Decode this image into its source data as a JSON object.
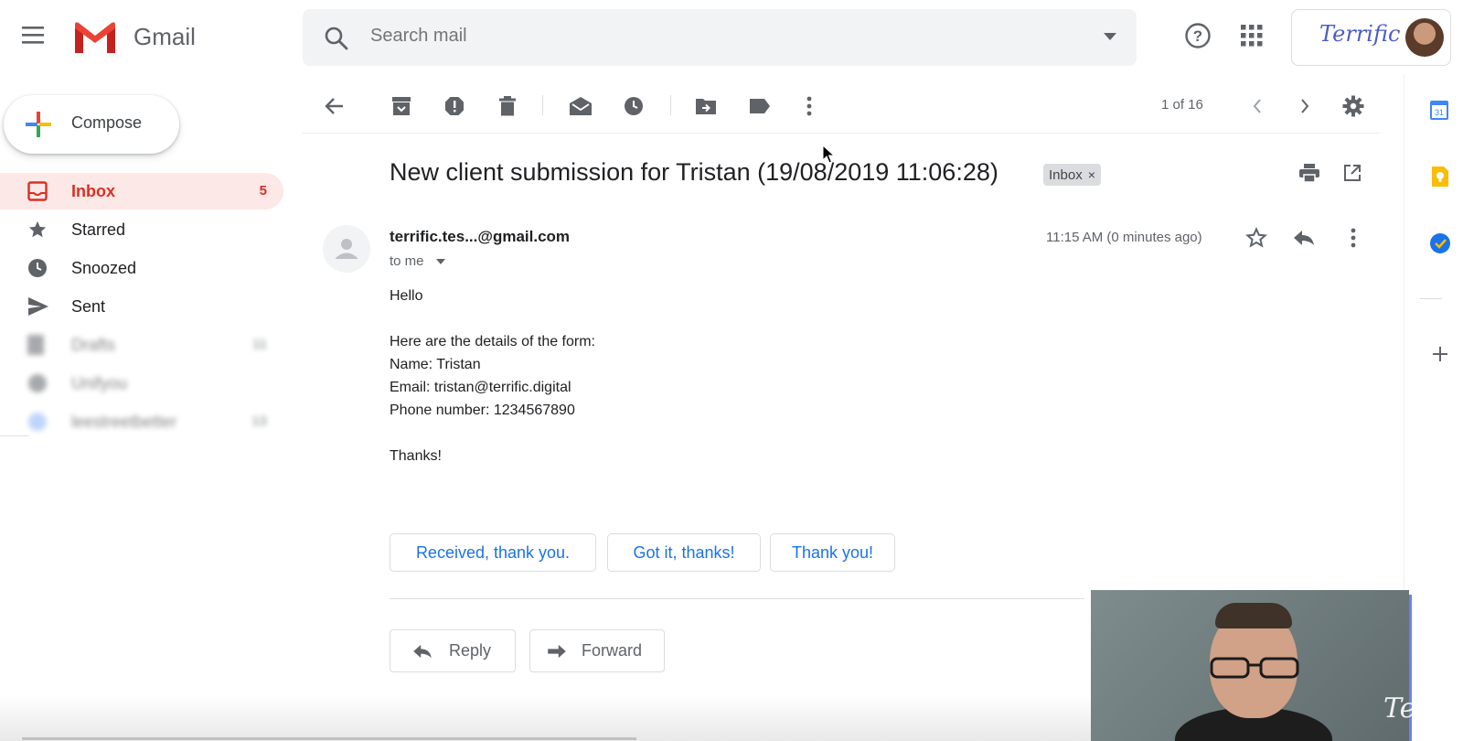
{
  "app": {
    "name": "Gmail"
  },
  "search": {
    "placeholder": "Search mail"
  },
  "account": {
    "brand": "Terrific"
  },
  "compose": {
    "label": "Compose"
  },
  "sidebar": {
    "items": [
      {
        "label": "Inbox",
        "count": "5"
      },
      {
        "label": "Starred",
        "count": ""
      },
      {
        "label": "Snoozed",
        "count": ""
      },
      {
        "label": "Sent",
        "count": ""
      },
      {
        "label": "Drafts",
        "count": "11"
      },
      {
        "label": "Unifyou",
        "count": ""
      },
      {
        "label": "leestreetbetter",
        "count": "13"
      }
    ]
  },
  "toolbar": {
    "pager": "1 of 16"
  },
  "message": {
    "subject": "New client submission for Tristan (19/08/2019 11:06:28)",
    "label_chip": "Inbox",
    "chip_close": "×",
    "sender": "terrific.tes...@gmail.com",
    "recipient": "to me",
    "time": "11:15 AM (0 minutes ago)",
    "body_lines": [
      "Hello",
      "",
      "Here are the details of the form:",
      "Name: Tristan",
      "Email: tristan@terrific.digital",
      "Phone number: 1234567890",
      "",
      "Thanks!"
    ]
  },
  "smart_replies": [
    "Received, thank you.",
    "Got it, thanks!",
    "Thank you!"
  ],
  "actions": {
    "reply": "Reply",
    "forward": "Forward"
  },
  "overlay": {
    "brand": "Terrific"
  },
  "icons": {
    "menu": "hamburger-menu-icon",
    "search": "search-icon",
    "help": "help-icon",
    "apps": "apps-grid-icon",
    "back": "back-arrow-icon",
    "archive": "archive-icon",
    "spam": "report-spam-icon",
    "delete": "delete-icon",
    "mark_unread": "mark-unread-icon",
    "snooze": "snooze-icon",
    "move": "move-to-icon",
    "label": "label-icon",
    "more": "more-vert-icon",
    "settings": "settings-gear-icon",
    "print": "print-icon",
    "new_window": "open-new-window-icon",
    "star": "star-icon",
    "reply": "reply-icon",
    "calendar": "calendar-icon",
    "keep": "keep-icon",
    "tasks": "tasks-icon",
    "add": "add-icon"
  },
  "colors": {
    "accent_red": "#d93025",
    "active_bg": "#fce8e6",
    "link_blue": "#1a73e8",
    "icon_gray": "#5f6368"
  }
}
